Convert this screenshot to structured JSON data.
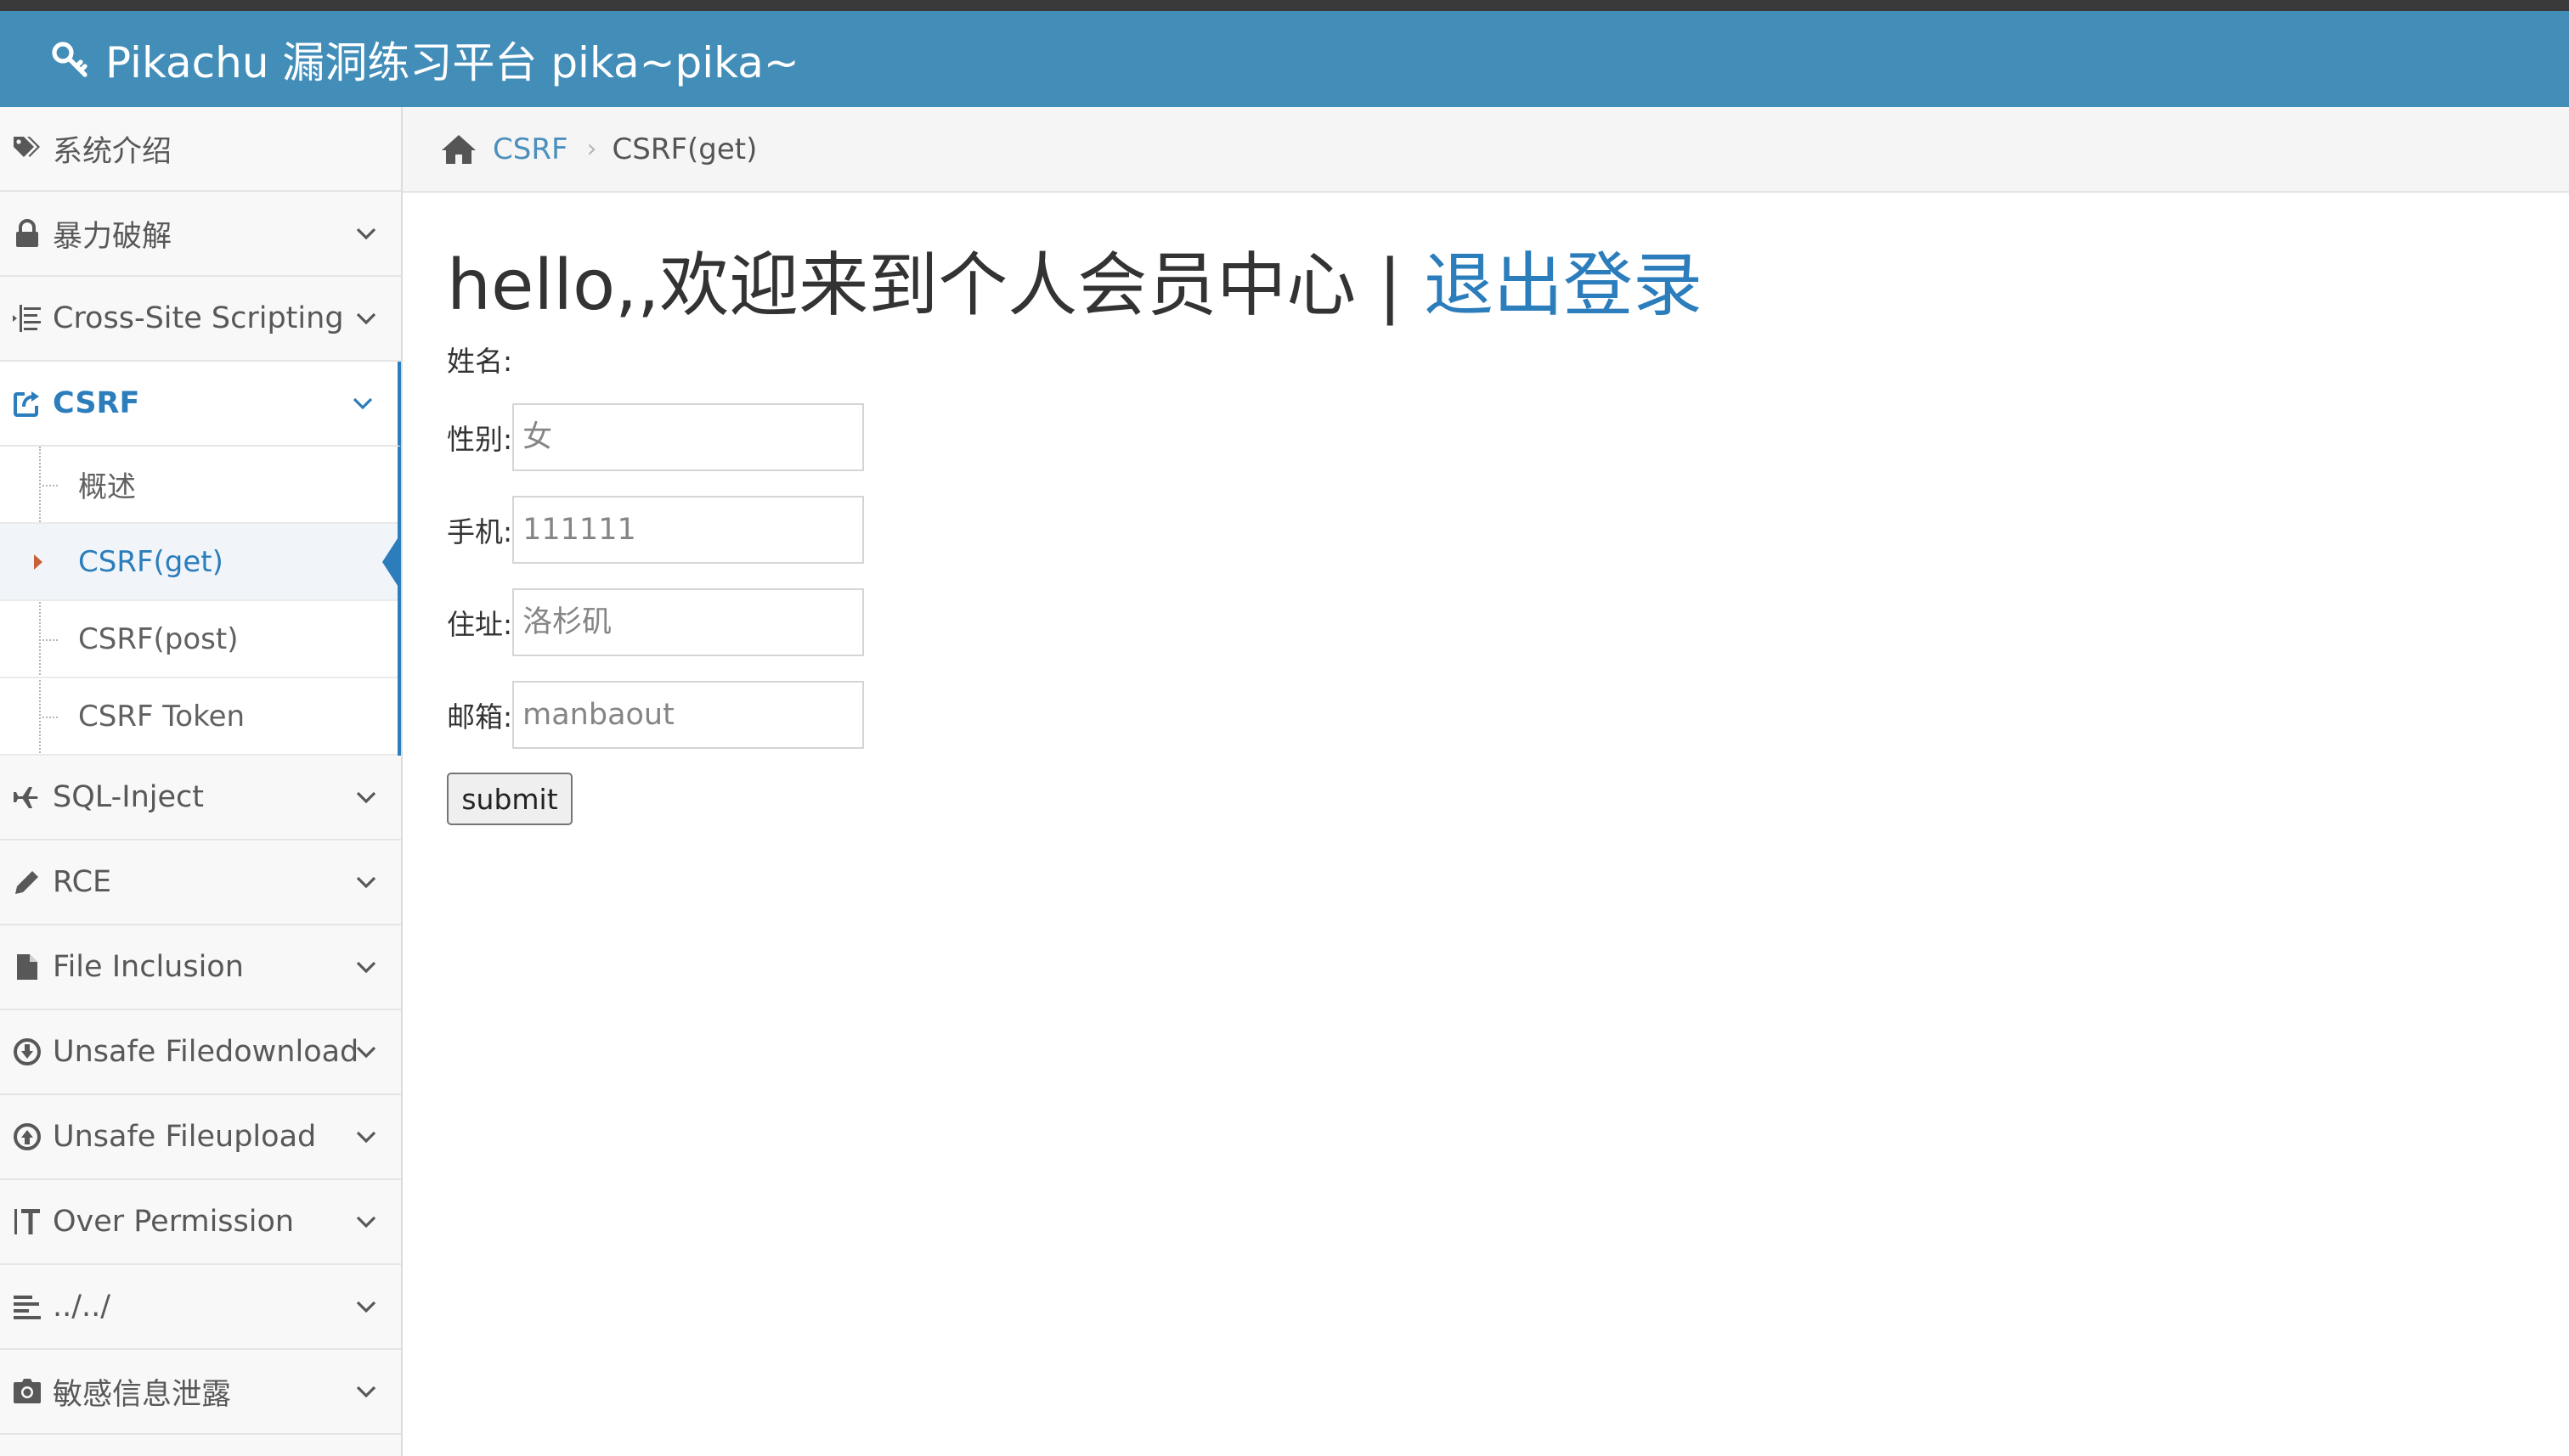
{
  "app": {
    "title": "Pikachu 漏洞练习平台 pika~pika~"
  },
  "colors": {
    "navbar": "#438eb9",
    "accent": "#2b7dbc",
    "sidebar_bg": "#f8f8f8",
    "caret": "#c86139"
  },
  "sidebar": {
    "items": [
      {
        "label": "系统介绍",
        "icon": "tags-icon"
      },
      {
        "label": "暴力破解",
        "icon": "lock-icon"
      },
      {
        "label": "Cross-Site Scripting",
        "icon": "list-indent-icon"
      },
      {
        "label": "CSRF",
        "icon": "share-square-icon",
        "active": true,
        "children": [
          {
            "label": "概述"
          },
          {
            "label": "CSRF(get)",
            "current": true
          },
          {
            "label": "CSRF(post)"
          },
          {
            "label": "CSRF Token"
          }
        ]
      },
      {
        "label": "SQL-Inject",
        "icon": "plane-icon"
      },
      {
        "label": "RCE",
        "icon": "pencil-icon"
      },
      {
        "label": "File Inclusion",
        "icon": "file-icon"
      },
      {
        "label": "Unsafe Filedownload",
        "icon": "download-circle-icon"
      },
      {
        "label": "Unsafe Fileupload",
        "icon": "upload-circle-icon"
      },
      {
        "label": "Over Permission",
        "icon": "text-height-icon"
      },
      {
        "label": "../../",
        "icon": "align-left-icon"
      },
      {
        "label": "敏感信息泄露",
        "icon": "camera-icon"
      }
    ]
  },
  "breadcrumb": {
    "home_icon": "home-icon",
    "parent": "CSRF",
    "current": "CSRF(get)"
  },
  "main": {
    "welcome": "hello,,欢迎来到个人会员中心 | ",
    "logout": "退出登录",
    "form": {
      "name_label": "姓名:",
      "fields": [
        {
          "label": "性别:",
          "placeholder": "女"
        },
        {
          "label": "手机:",
          "placeholder": "111111"
        },
        {
          "label": "住址:",
          "placeholder": "洛杉矶"
        },
        {
          "label": "邮箱:",
          "placeholder": "manbaout"
        }
      ],
      "submit": "submit"
    }
  }
}
